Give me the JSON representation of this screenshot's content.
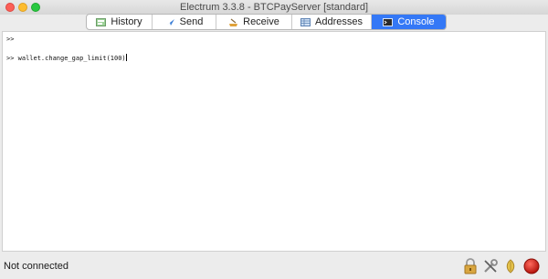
{
  "window": {
    "title": "Electrum 3.3.8  -  BTCPayServer  [standard]"
  },
  "tabs": [
    {
      "label": "History",
      "icon": "history-icon"
    },
    {
      "label": "Send",
      "icon": "send-icon"
    },
    {
      "label": "Receive",
      "icon": "receive-icon"
    },
    {
      "label": "Addresses",
      "icon": "addresses-icon"
    },
    {
      "label": "Console",
      "icon": "console-icon",
      "active": true
    }
  ],
  "console": {
    "lines": [
      ">>",
      ">> wallet.change_gap_limit(100)"
    ]
  },
  "status": {
    "text": "Not connected",
    "icons": [
      "lock-icon",
      "preferences-icon",
      "seed-icon",
      "network-status-icon"
    ],
    "accent_color": "#3478f6",
    "network_status_color": "#d81e14"
  }
}
